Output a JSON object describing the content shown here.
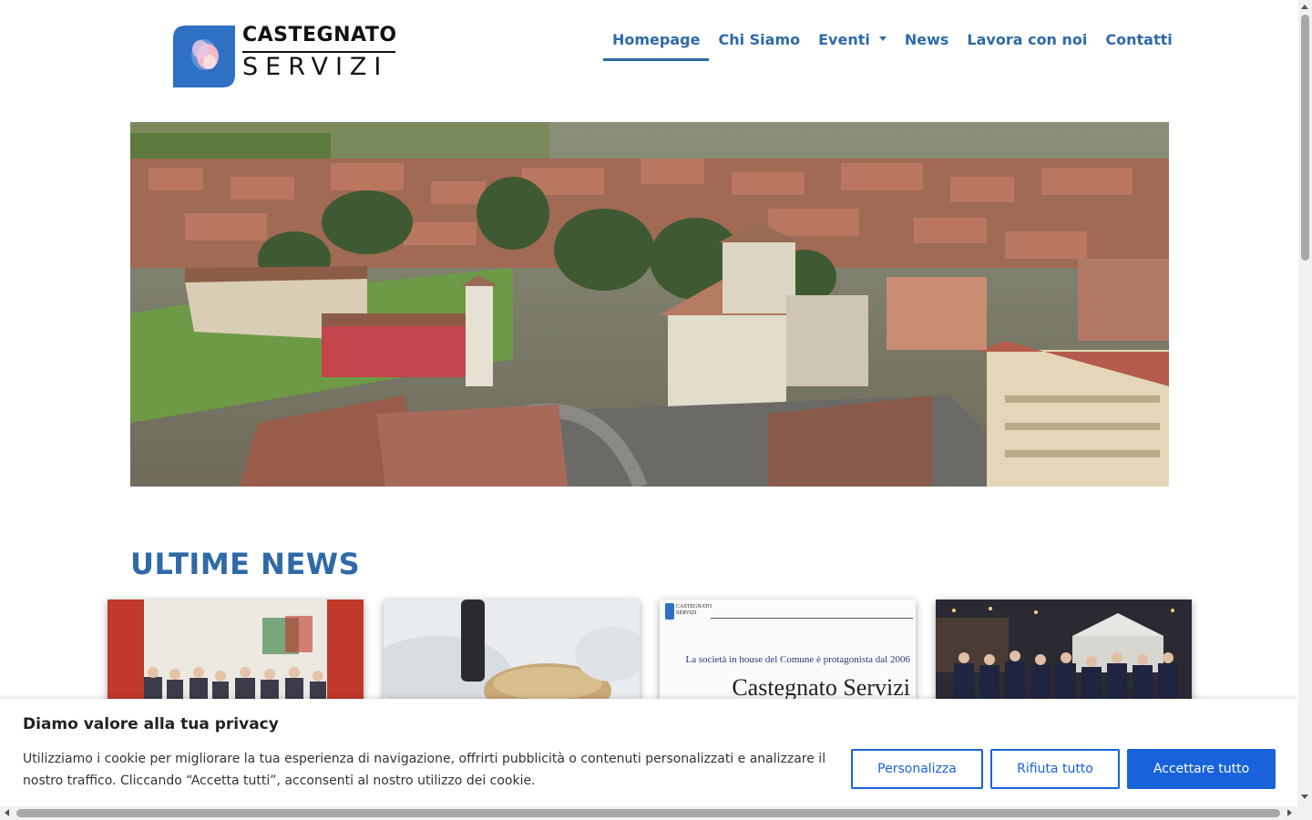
{
  "brand": {
    "name_line1": "CASTEGNATO",
    "name_line2": "SERVIZI",
    "logo_icon": "castegnato-servizi-logo-icon",
    "colors": {
      "primary": "#2e6aa8",
      "logo_blue": "#2f6fc4",
      "logo_pink": "#f2b8c4"
    }
  },
  "nav": {
    "items": [
      {
        "label": "Homepage",
        "active": true
      },
      {
        "label": "Chi Siamo"
      },
      {
        "label": "Eventi",
        "has_dropdown": true
      },
      {
        "label": "News"
      },
      {
        "label": "Lavora con noi"
      },
      {
        "label": "Contatti"
      }
    ]
  },
  "hero": {
    "image": "aerial-town-photo"
  },
  "news": {
    "title": "ULTIME NEWS",
    "cards": [
      {
        "image": "group-photo-event"
      },
      {
        "image": "wine-bottle-table"
      },
      {
        "image": "newspaper-clipping",
        "header_brand": "CASTEGNATO SERVIZI",
        "headline_small": "La società in house del Comune è protagonista dal 2006",
        "headline_large": "Castegnato Servizi"
      },
      {
        "image": "night-festival-group"
      }
    ]
  },
  "cookie": {
    "title": "Diamo valore alla tua privacy",
    "text": "Utilizziamo i cookie per migliorare la tua esperienza di navigazione, offrirti pubblicità o contenuti personalizzati e analizzare il nostro traffico. Cliccando “Accetta tutti”, acconsenti al nostro utilizzo dei cookie.",
    "buttons": {
      "customize": "Personalizza",
      "reject": "Rifiuta tutto",
      "accept": "Accettare tutto"
    },
    "accent": "#1863dc"
  }
}
